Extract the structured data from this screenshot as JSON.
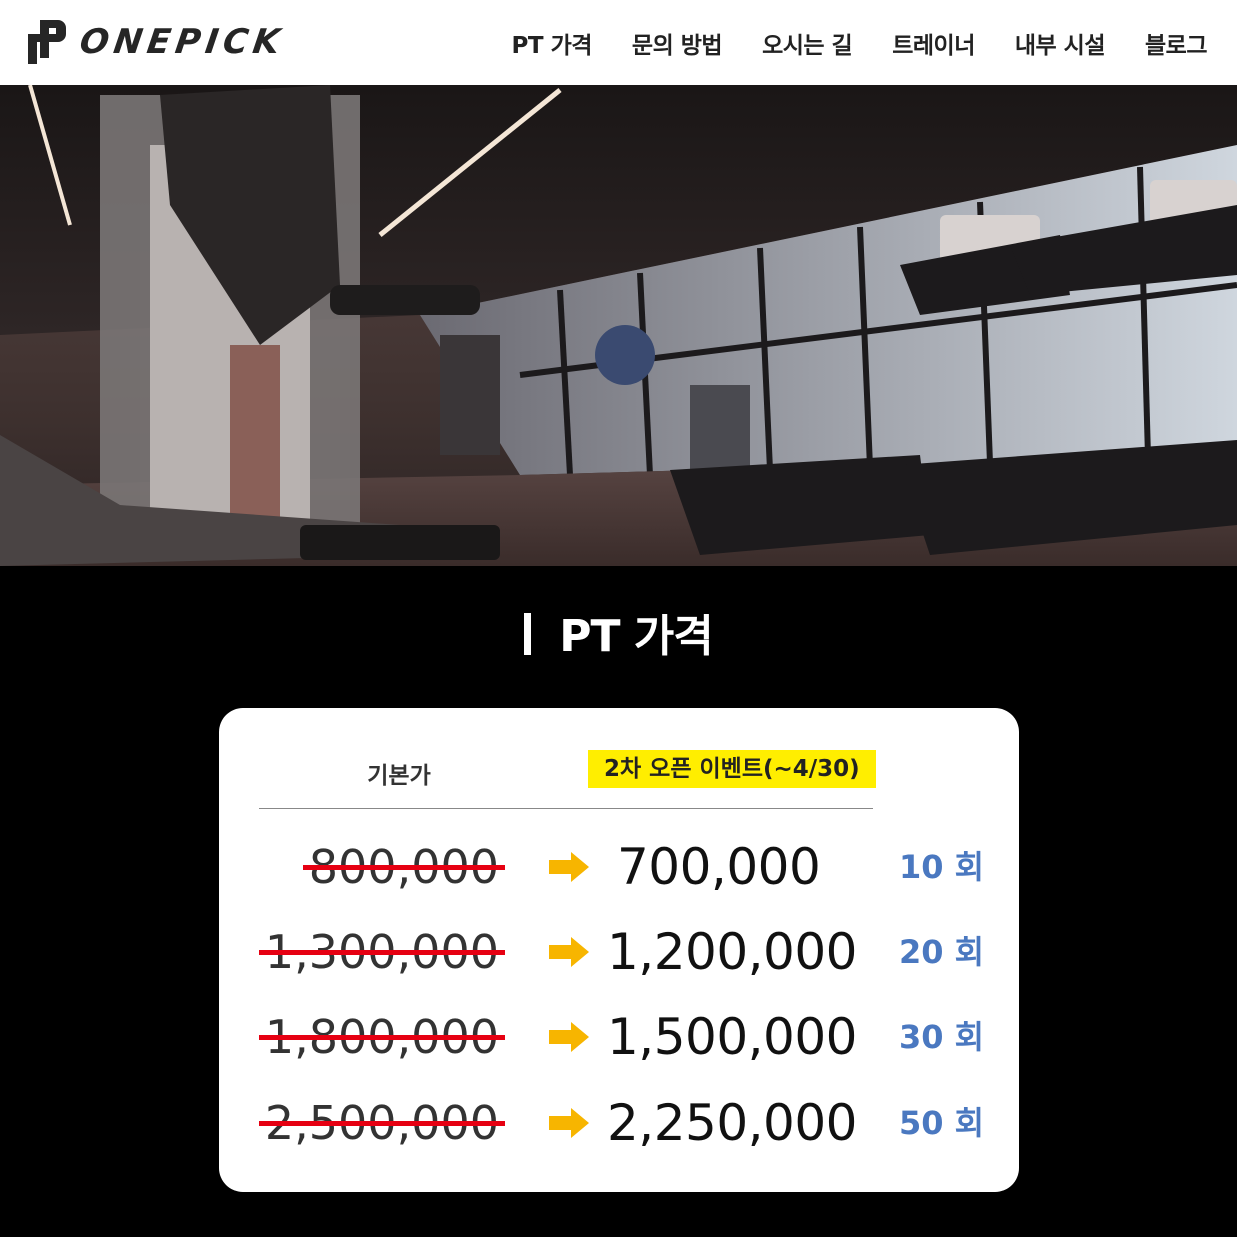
{
  "header": {
    "logo_text": "ONEPICK",
    "nav": [
      "PT 가격",
      "문의 방법",
      "오시는 길",
      "트레이너",
      "내부 시설",
      "블로그"
    ]
  },
  "section": {
    "title": "PT 가격"
  },
  "pricing": {
    "base_label": "기본가",
    "event_label": "2차 오픈 이벤트(~4/30)",
    "rows": [
      {
        "original": "800,000",
        "discounted": "700,000",
        "sessions": "10 회"
      },
      {
        "original": "1,300,000",
        "discounted": "1,200,000",
        "sessions": "20 회"
      },
      {
        "original": "1,800,000",
        "discounted": "1,500,000",
        "sessions": "30 회"
      },
      {
        "original": "2,500,000",
        "discounted": "2,250,000",
        "sessions": "50 회"
      }
    ]
  },
  "colors": {
    "accent_yellow": "#ffee00",
    "strike_red": "#e60012",
    "arrow_orange": "#f7b500",
    "sessions_blue": "#4a78c0"
  }
}
